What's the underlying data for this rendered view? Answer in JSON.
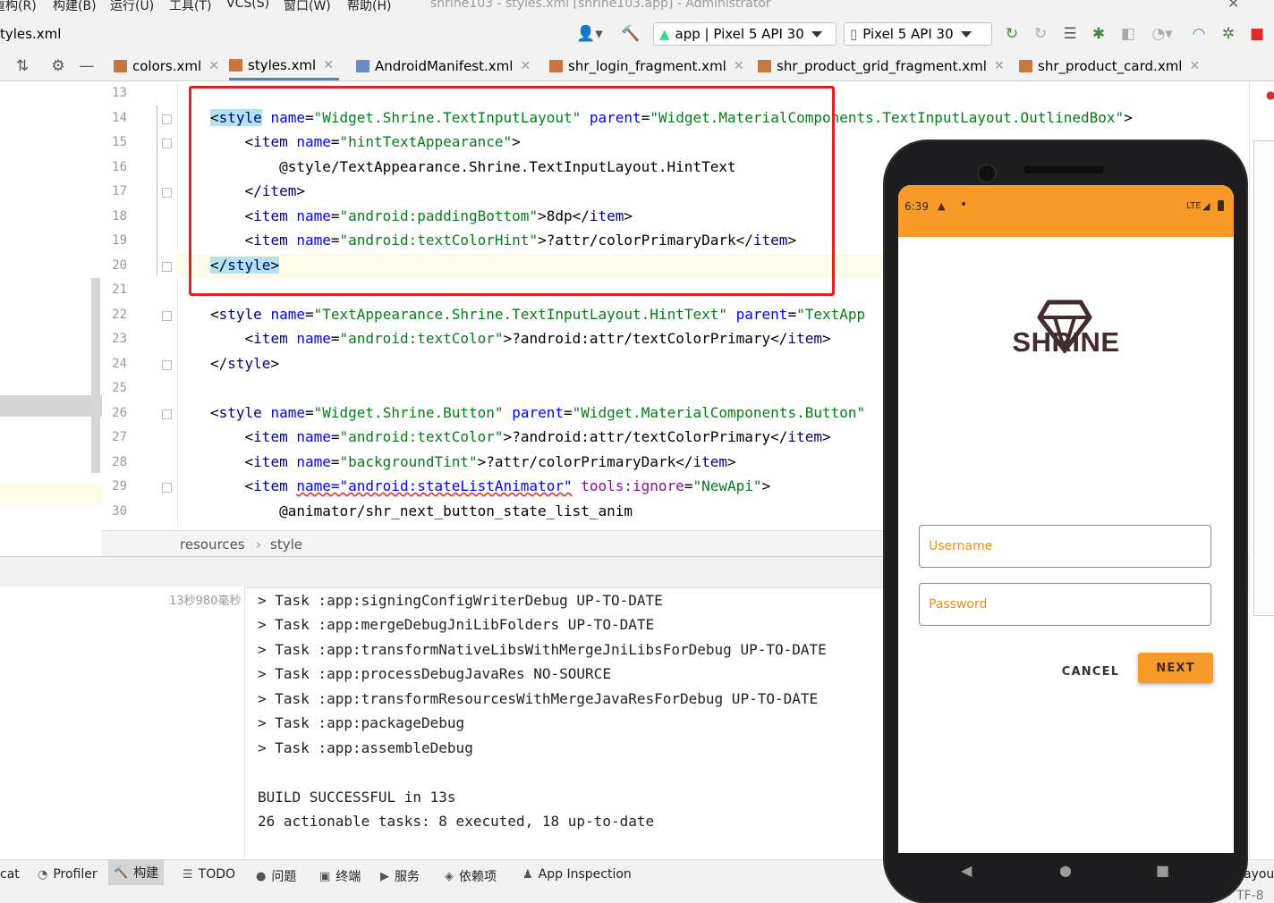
{
  "menubar": {
    "items": [
      "重构(R)",
      "构建(B)",
      "运行(U)",
      "工具(T)",
      "VCS(S)",
      "窗口(W)",
      "帮助(H)"
    ],
    "window_title": "shrine103 - styles.xml [shrine103.app] - Administrator"
  },
  "toolbar": {
    "file_crumb": "tyles.xml",
    "run_config": "app | Pixel 5 API 30",
    "device": "Pixel 5 API 30"
  },
  "tabs": [
    {
      "label": "colors.xml",
      "active": false
    },
    {
      "label": "styles.xml",
      "active": true
    },
    {
      "label": "AndroidManifest.xml",
      "active": false
    },
    {
      "label": "shr_login_fragment.xml",
      "active": false
    },
    {
      "label": "shr_product_grid_fragment.xml",
      "active": false
    },
    {
      "label": "shr_product_card.xml",
      "active": false
    }
  ],
  "editor": {
    "line_numbers": [
      "13",
      "14",
      "15",
      "16",
      "17",
      "18",
      "19",
      "20",
      "21",
      "22",
      "23",
      "24",
      "25",
      "26",
      "27",
      "28",
      "29",
      "30"
    ],
    "lines": {
      "l14_a": "style",
      "l14_b": "name",
      "l14_c": "\"Widget.Shrine.TextInputLayout\"",
      "l14_d": "parent",
      "l14_e": "\"Widget.MaterialComponents.TextInputLayout.OutlinedBox\"",
      "l15_a": "item",
      "l15_b": "name",
      "l15_c": "\"hintTextAppearance\"",
      "l16": "@style/TextAppearance.Shrine.TextInputLayout.HintText",
      "l17": "item",
      "l18_a": "item",
      "l18_b": "name",
      "l18_c": "\"android:paddingBottom\"",
      "l18_d": "8dp",
      "l19_a": "item",
      "l19_b": "name",
      "l19_c": "\"android:textColorHint\"",
      "l19_d": "?attr/colorPrimaryDark",
      "l20": "style",
      "l22_a": "style",
      "l22_b": "name",
      "l22_c": "\"TextAppearance.Shrine.TextInputLayout.HintText\"",
      "l22_d": "parent",
      "l22_e": "\"TextApp",
      "l23_a": "item",
      "l23_b": "name",
      "l23_c": "\"android:textColor\"",
      "l23_d": "?android:attr/textColorPrimary",
      "l24": "style",
      "l26_a": "style",
      "l26_b": "name",
      "l26_c": "\"Widget.Shrine.Button\"",
      "l26_d": "parent",
      "l26_e": "\"Widget.MaterialComponents.Button\"",
      "l27_a": "item",
      "l27_b": "name",
      "l27_c": "\"android:textColor\"",
      "l27_d": "?android:attr/textColorPrimary",
      "l28_a": "item",
      "l28_b": "name",
      "l28_c": "\"backgroundTint\"",
      "l28_d": "?attr/colorPrimaryDark",
      "l29_a": "item",
      "l29_b": "name=\"android:stateListAnimator\"",
      "l29_c": "tools:ignore",
      "l29_d": "\"NewApi\"",
      "l30": "@animator/shr_next_button_state_list_anim"
    },
    "breadcrumb": [
      "resources",
      "style"
    ]
  },
  "build": {
    "elapsed": "13秒980毫秒",
    "output": [
      "> Task :app:signingConfigWriterDebug UP-TO-DATE",
      "> Task :app:mergeDebugJniLibFolders UP-TO-DATE",
      "> Task :app:transformNativeLibsWithMergeJniLibsForDebug UP-TO-DATE",
      "> Task :app:processDebugJavaRes NO-SOURCE",
      "> Task :app:transformResourcesWithMergeJavaResForDebug UP-TO-DATE",
      "> Task :app:packageDebug",
      "> Task :app:assembleDebug",
      "",
      "BUILD SUCCESSFUL in 13s",
      "26 actionable tasks: 8 executed, 18 up-to-date"
    ]
  },
  "bottombar": {
    "items": [
      "cat",
      "Profiler",
      "构建",
      "TODO",
      "问题",
      "终端",
      "服务",
      "依赖项",
      "App Inspection"
    ],
    "right_a": "ayout",
    "right_b": "TF-8"
  },
  "phone": {
    "time": "6:39",
    "network": "LTE",
    "app_name": "SHRINE",
    "username_hint": "Username",
    "password_hint": "Password",
    "cancel_label": "CANCEL",
    "next_label": "NEXT",
    "accent_color": "#f89a28",
    "brand_text_color": "#442b2d"
  }
}
